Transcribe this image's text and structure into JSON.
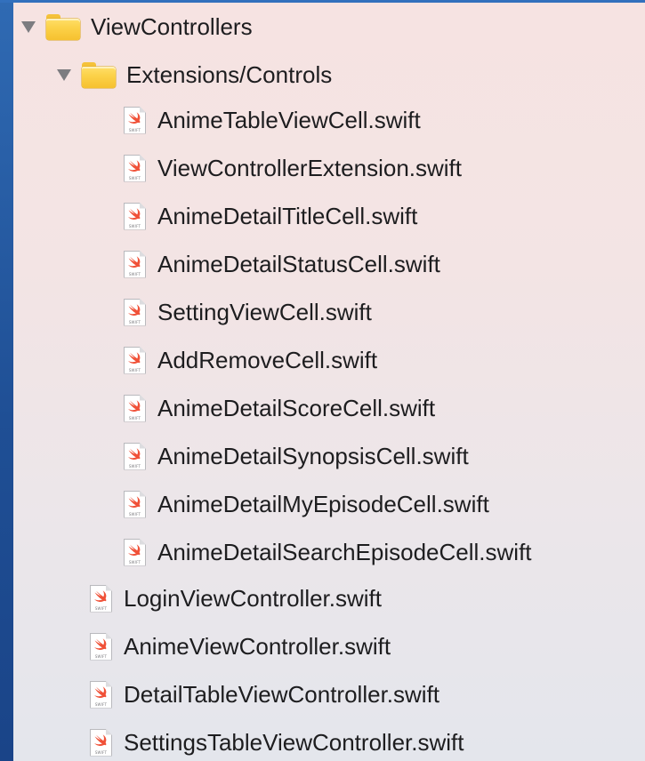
{
  "navigator": {
    "root_folder": {
      "label": "ViewControllers",
      "expanded": true,
      "icon": "folder-icon",
      "disclosure_icon": "disclosure-triangle-down-icon"
    },
    "sub_folder": {
      "label": "Extensions/Controls",
      "expanded": true,
      "icon": "folder-icon",
      "disclosure_icon": "disclosure-triangle-down-icon"
    },
    "file_icon_caption": "SWIFT",
    "sub_folder_files": [
      {
        "label": "AnimeTableViewCell.swift"
      },
      {
        "label": "ViewControllerExtension.swift"
      },
      {
        "label": "AnimeDetailTitleCell.swift"
      },
      {
        "label": "AnimeDetailStatusCell.swift"
      },
      {
        "label": "SettingViewCell.swift"
      },
      {
        "label": "AddRemoveCell.swift"
      },
      {
        "label": "AnimeDetailScoreCell.swift"
      },
      {
        "label": "AnimeDetailSynopsisCell.swift"
      },
      {
        "label": "AnimeDetailMyEpisodeCell.swift"
      },
      {
        "label": "AnimeDetailSearchEpisodeCell.swift"
      }
    ],
    "root_files": [
      {
        "label": "LoginViewController.swift"
      },
      {
        "label": "AnimeViewController.swift"
      },
      {
        "label": "DetailTableViewController.swift"
      },
      {
        "label": "SettingsTableViewController.swift"
      }
    ],
    "colors": {
      "folder": "#f9c93f",
      "swift_logo": "#f05138",
      "text": "#1d1d1f",
      "disclosure": "#7c7c80"
    }
  }
}
